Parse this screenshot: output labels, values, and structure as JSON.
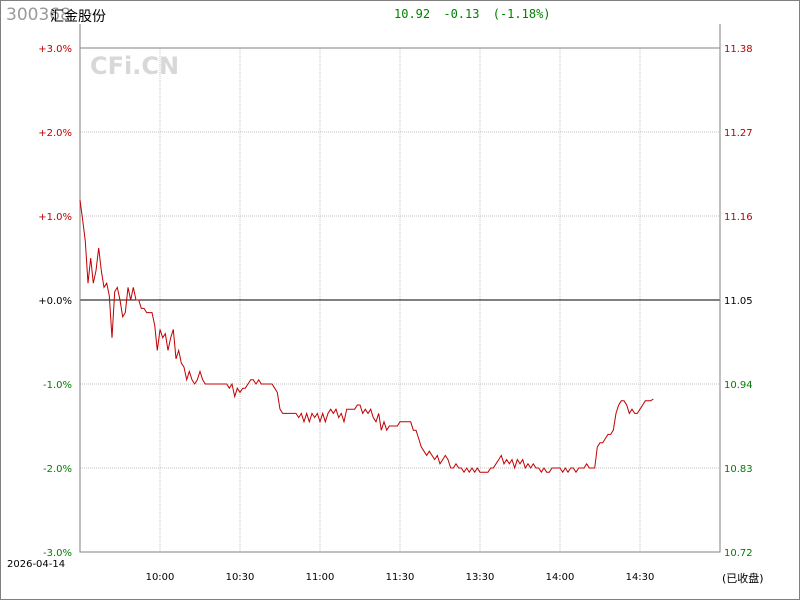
{
  "header": {
    "code": "300368",
    "name": "汇金股份",
    "price": "10.92",
    "change": "-0.13",
    "change_pct": "(-1.18%)"
  },
  "watermark": "CFi.CN",
  "date_label": "2026-04-14",
  "closed_label": "(已收盘)",
  "colors": {
    "up": "#c00000",
    "down": "#008000",
    "line": "#c00000",
    "grid": "#c0c0c0",
    "axis_text": "#000000",
    "watermark": "#d8d8d8"
  },
  "chart_data": {
    "type": "line",
    "title": "",
    "xlabel": "",
    "ylabel": "",
    "prev_close": 11.05,
    "ylim_pct": [
      -3.0,
      3.0
    ],
    "left_ticks": [
      "+3.0%",
      "+2.0%",
      "+1.0%",
      "+0.0%",
      "-1.0%",
      "-2.0%",
      "-3.0%"
    ],
    "left_tick_values": [
      3,
      2,
      1,
      0,
      -1,
      -2,
      -3
    ],
    "right_ticks": [
      "11.38",
      "11.27",
      "11.16",
      "11.05",
      "10.94",
      "10.83",
      "10.72"
    ],
    "x_ticks": [
      "10:00",
      "10:30",
      "11:00",
      "11:30",
      "13:30",
      "14:00",
      "14:30"
    ],
    "x_tick_minutes": [
      30,
      60,
      90,
      120,
      150,
      180,
      210
    ],
    "x_range_minutes": [
      0,
      240
    ],
    "grid": true,
    "series": [
      {
        "points": [
          [
            0,
            1.19
          ],
          [
            1,
            0.95
          ],
          [
            2,
            0.7
          ],
          [
            3,
            0.2
          ],
          [
            4,
            0.5
          ],
          [
            5,
            0.2
          ],
          [
            6,
            0.35
          ],
          [
            7,
            0.62
          ],
          [
            8,
            0.35
          ],
          [
            9,
            0.15
          ],
          [
            10,
            0.2
          ],
          [
            11,
            0.05
          ],
          [
            12,
            -0.45
          ],
          [
            13,
            0.1
          ],
          [
            14,
            0.15
          ],
          [
            15,
            0.0
          ],
          [
            16,
            -0.2
          ],
          [
            17,
            -0.15
          ],
          [
            18,
            0.15
          ],
          [
            19,
            0.0
          ],
          [
            20,
            0.15
          ],
          [
            21,
            0.0
          ],
          [
            22,
            0.0
          ],
          [
            23,
            -0.1
          ],
          [
            24,
            -0.1
          ],
          [
            25,
            -0.15
          ],
          [
            26,
            -0.15
          ],
          [
            27,
            -0.15
          ],
          [
            28,
            -0.3
          ],
          [
            29,
            -0.6
          ],
          [
            30,
            -0.35
          ],
          [
            31,
            -0.45
          ],
          [
            32,
            -0.4
          ],
          [
            33,
            -0.6
          ],
          [
            34,
            -0.45
          ],
          [
            35,
            -0.35
          ],
          [
            36,
            -0.7
          ],
          [
            37,
            -0.6
          ],
          [
            38,
            -0.75
          ],
          [
            39,
            -0.8
          ],
          [
            40,
            -0.95
          ],
          [
            41,
            -0.85
          ],
          [
            42,
            -0.95
          ],
          [
            43,
            -1.0
          ],
          [
            44,
            -0.95
          ],
          [
            45,
            -0.85
          ],
          [
            46,
            -0.95
          ],
          [
            47,
            -1.0
          ],
          [
            48,
            -1.0
          ],
          [
            49,
            -1.0
          ],
          [
            50,
            -1.0
          ],
          [
            51,
            -1.0
          ],
          [
            52,
            -1.0
          ],
          [
            53,
            -1.0
          ],
          [
            54,
            -1.0
          ],
          [
            55,
            -1.0
          ],
          [
            56,
            -1.05
          ],
          [
            57,
            -1.0
          ],
          [
            58,
            -1.15
          ],
          [
            59,
            -1.05
          ],
          [
            60,
            -1.1
          ],
          [
            61,
            -1.05
          ],
          [
            62,
            -1.05
          ],
          [
            63,
            -1.0
          ],
          [
            64,
            -0.95
          ],
          [
            65,
            -0.95
          ],
          [
            66,
            -1.0
          ],
          [
            67,
            -0.95
          ],
          [
            68,
            -1.0
          ],
          [
            69,
            -1.0
          ],
          [
            70,
            -1.0
          ],
          [
            71,
            -1.0
          ],
          [
            72,
            -1.0
          ],
          [
            73,
            -1.05
          ],
          [
            74,
            -1.1
          ],
          [
            75,
            -1.3
          ],
          [
            76,
            -1.35
          ],
          [
            77,
            -1.35
          ],
          [
            78,
            -1.35
          ],
          [
            79,
            -1.35
          ],
          [
            80,
            -1.35
          ],
          [
            81,
            -1.35
          ],
          [
            82,
            -1.4
          ],
          [
            83,
            -1.35
          ],
          [
            84,
            -1.45
          ],
          [
            85,
            -1.35
          ],
          [
            86,
            -1.45
          ],
          [
            87,
            -1.35
          ],
          [
            88,
            -1.4
          ],
          [
            89,
            -1.35
          ],
          [
            90,
            -1.45
          ],
          [
            91,
            -1.35
          ],
          [
            92,
            -1.45
          ],
          [
            93,
            -1.35
          ],
          [
            94,
            -1.3
          ],
          [
            95,
            -1.35
          ],
          [
            96,
            -1.3
          ],
          [
            97,
            -1.4
          ],
          [
            98,
            -1.35
          ],
          [
            99,
            -1.45
          ],
          [
            100,
            -1.3
          ],
          [
            101,
            -1.3
          ],
          [
            102,
            -1.3
          ],
          [
            103,
            -1.3
          ],
          [
            104,
            -1.25
          ],
          [
            105,
            -1.25
          ],
          [
            106,
            -1.35
          ],
          [
            107,
            -1.3
          ],
          [
            108,
            -1.35
          ],
          [
            109,
            -1.3
          ],
          [
            110,
            -1.4
          ],
          [
            111,
            -1.45
          ],
          [
            112,
            -1.35
          ],
          [
            113,
            -1.55
          ],
          [
            114,
            -1.45
          ],
          [
            115,
            -1.55
          ],
          [
            116,
            -1.5
          ],
          [
            117,
            -1.5
          ],
          [
            118,
            -1.5
          ],
          [
            119,
            -1.5
          ],
          [
            120,
            -1.45
          ],
          [
            121,
            -1.45
          ],
          [
            122,
            -1.45
          ],
          [
            123,
            -1.45
          ],
          [
            124,
            -1.45
          ],
          [
            125,
            -1.55
          ],
          [
            126,
            -1.55
          ],
          [
            127,
            -1.65
          ],
          [
            128,
            -1.75
          ],
          [
            129,
            -1.8
          ],
          [
            130,
            -1.85
          ],
          [
            131,
            -1.8
          ],
          [
            132,
            -1.85
          ],
          [
            133,
            -1.9
          ],
          [
            134,
            -1.85
          ],
          [
            135,
            -1.95
          ],
          [
            136,
            -1.9
          ],
          [
            137,
            -1.85
          ],
          [
            138,
            -1.9
          ],
          [
            139,
            -2.0
          ],
          [
            140,
            -2.0
          ],
          [
            141,
            -1.95
          ],
          [
            142,
            -2.0
          ],
          [
            143,
            -2.0
          ],
          [
            144,
            -2.05
          ],
          [
            145,
            -2.0
          ],
          [
            146,
            -2.05
          ],
          [
            147,
            -2.0
          ],
          [
            148,
            -2.05
          ],
          [
            149,
            -2.0
          ],
          [
            150,
            -2.05
          ],
          [
            151,
            -2.05
          ],
          [
            152,
            -2.05
          ],
          [
            153,
            -2.05
          ],
          [
            154,
            -2.0
          ],
          [
            155,
            -2.0
          ],
          [
            156,
            -1.95
          ],
          [
            157,
            -1.9
          ],
          [
            158,
            -1.85
          ],
          [
            159,
            -1.95
          ],
          [
            160,
            -1.9
          ],
          [
            161,
            -1.95
          ],
          [
            162,
            -1.9
          ],
          [
            163,
            -2.0
          ],
          [
            164,
            -1.9
          ],
          [
            165,
            -1.95
          ],
          [
            166,
            -1.9
          ],
          [
            167,
            -2.0
          ],
          [
            168,
            -1.95
          ],
          [
            169,
            -2.0
          ],
          [
            170,
            -1.95
          ],
          [
            171,
            -2.0
          ],
          [
            172,
            -2.0
          ],
          [
            173,
            -2.05
          ],
          [
            174,
            -2.0
          ],
          [
            175,
            -2.05
          ],
          [
            176,
            -2.05
          ],
          [
            177,
            -2.0
          ],
          [
            178,
            -2.0
          ],
          [
            179,
            -2.0
          ],
          [
            180,
            -2.0
          ],
          [
            181,
            -2.05
          ],
          [
            182,
            -2.0
          ],
          [
            183,
            -2.05
          ],
          [
            184,
            -2.0
          ],
          [
            185,
            -2.0
          ],
          [
            186,
            -2.05
          ],
          [
            187,
            -2.0
          ],
          [
            188,
            -2.0
          ],
          [
            189,
            -2.0
          ],
          [
            190,
            -1.95
          ],
          [
            191,
            -2.0
          ],
          [
            192,
            -2.0
          ],
          [
            193,
            -2.0
          ],
          [
            194,
            -1.75
          ],
          [
            195,
            -1.7
          ],
          [
            196,
            -1.7
          ],
          [
            197,
            -1.65
          ],
          [
            198,
            -1.6
          ],
          [
            199,
            -1.6
          ],
          [
            200,
            -1.55
          ],
          [
            201,
            -1.35
          ],
          [
            202,
            -1.25
          ],
          [
            203,
            -1.2
          ],
          [
            204,
            -1.2
          ],
          [
            205,
            -1.25
          ],
          [
            206,
            -1.35
          ],
          [
            207,
            -1.3
          ],
          [
            208,
            -1.35
          ],
          [
            209,
            -1.35
          ],
          [
            210,
            -1.3
          ],
          [
            211,
            -1.25
          ],
          [
            212,
            -1.2
          ],
          [
            213,
            -1.2
          ],
          [
            214,
            -1.2
          ],
          [
            215,
            -1.18
          ]
        ]
      }
    ]
  }
}
